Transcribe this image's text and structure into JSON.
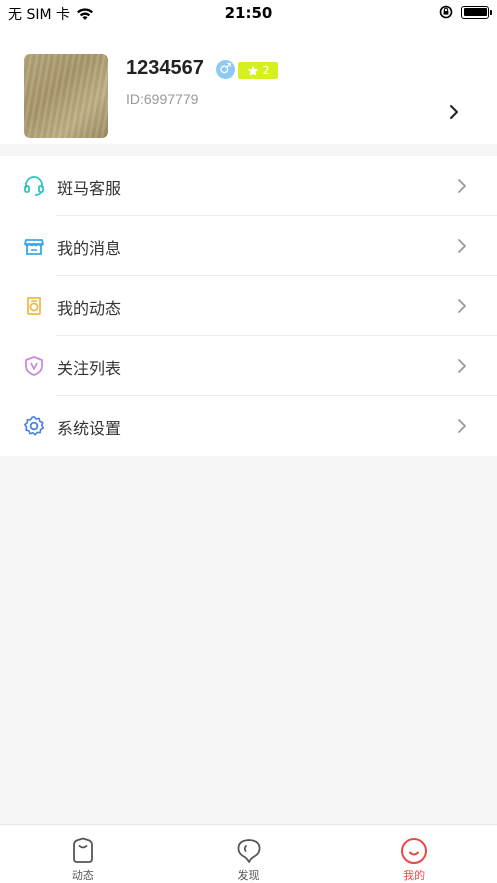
{
  "status_bar": {
    "carrier": "无 SIM 卡",
    "time": "21:50"
  },
  "profile": {
    "username": "1234567",
    "gender_icon": "male-icon",
    "level": "2",
    "user_id": "ID:6997779"
  },
  "menu": {
    "items": [
      {
        "label": "斑马客服",
        "icon": "headset-icon",
        "color": "#2ec5c0"
      },
      {
        "label": "我的消息",
        "icon": "store-icon",
        "color": "#3aa8e6"
      },
      {
        "label": "我的动态",
        "icon": "camera-icon",
        "color": "#f0b94a"
      },
      {
        "label": "关注列表",
        "icon": "shield-icon",
        "color": "#c98be0"
      },
      {
        "label": "系统设置",
        "icon": "gear-icon",
        "color": "#4a82e0"
      }
    ]
  },
  "tabbar": {
    "tabs": [
      {
        "label": "动态",
        "icon": "feed-icon",
        "active": false
      },
      {
        "label": "发现",
        "icon": "discover-icon",
        "active": false
      },
      {
        "label": "我的",
        "icon": "profile-icon",
        "active": true
      }
    ]
  },
  "colors": {
    "accent": "#e94a4a",
    "level_badge": "#d6f01f",
    "gender": "#8ec9f5"
  }
}
